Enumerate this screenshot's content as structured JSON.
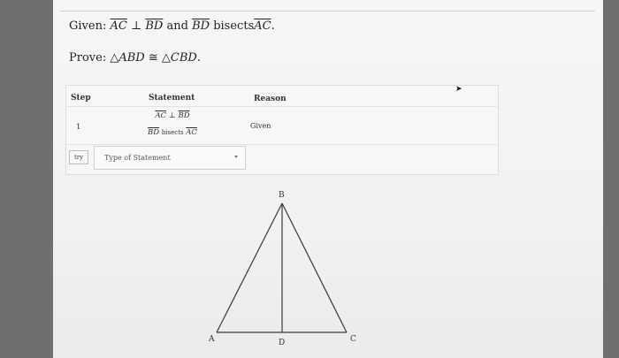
{
  "given": {
    "label": "Given:",
    "seg1": "AC",
    "perp": "⊥",
    "seg2": "BD",
    "and": "and",
    "seg3": "BD",
    "bisects": "bisects",
    "seg4": "AC",
    "end": "."
  },
  "prove": {
    "label": "Prove:",
    "tri1": "△ABD",
    "congruent": "≅",
    "tri2": "△CBD",
    "end": "."
  },
  "table": {
    "headers": {
      "step": "Step",
      "statement": "Statement",
      "reason": "Reason"
    },
    "rows": [
      {
        "step": "1",
        "statement_line1": {
          "seg1": "AC",
          "perp": "⊥",
          "seg2": "BD"
        },
        "statement_line2": {
          "seg1": "BD",
          "word": "bisects",
          "seg2": "AC"
        },
        "reason": "Given"
      }
    ]
  },
  "input_row": {
    "try_label": "try",
    "statement_placeholder": "Type of Statement"
  },
  "diagram": {
    "labels": {
      "A": "A",
      "B": "B",
      "C": "C",
      "D": "D"
    }
  }
}
